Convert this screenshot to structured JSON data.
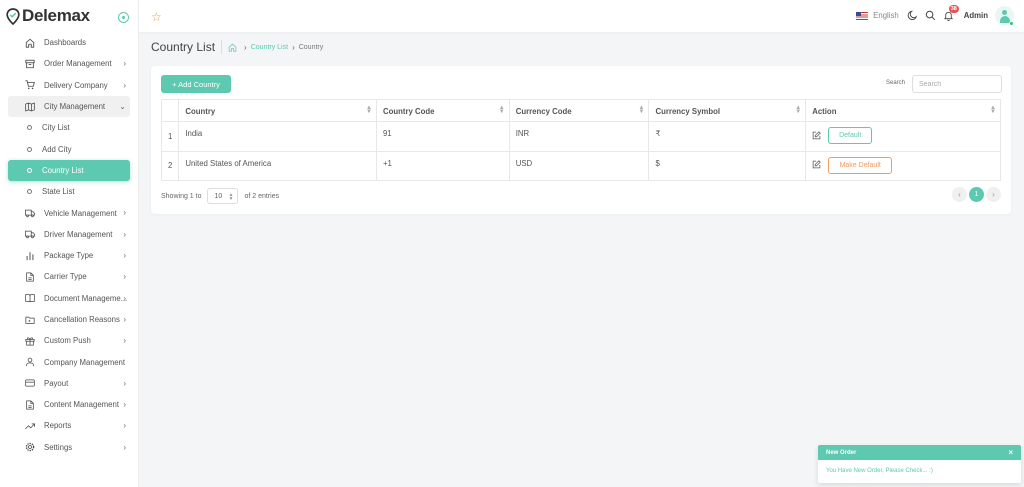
{
  "brand": {
    "name": "Delemax"
  },
  "sidebar": {
    "items": [
      {
        "label": "Dashboards",
        "icon": "home-icon"
      },
      {
        "label": "Order Management",
        "icon": "archive-icon",
        "chevron": true
      },
      {
        "label": "Delivery Company",
        "icon": "cart-icon",
        "chevron": true
      },
      {
        "label": "City Management",
        "icon": "map-icon",
        "chevron": true,
        "open": true
      },
      {
        "label": "City List",
        "sub": true
      },
      {
        "label": "Add City",
        "sub": true
      },
      {
        "label": "Country List",
        "sub": true,
        "active": true
      },
      {
        "label": "State List",
        "sub": true
      },
      {
        "label": "Vehicle Management",
        "icon": "truck-icon",
        "chevron": true
      },
      {
        "label": "Driver Management",
        "icon": "truck-icon",
        "chevron": true
      },
      {
        "label": "Package Type",
        "icon": "bar-chart-icon",
        "chevron": true
      },
      {
        "label": "Carrier Type",
        "icon": "file-icon",
        "chevron": true
      },
      {
        "label": "Document Manageme...",
        "icon": "book-icon",
        "chevron": true
      },
      {
        "label": "Cancellation Reasons",
        "icon": "folder-icon",
        "chevron": true
      },
      {
        "label": "Custom Push",
        "icon": "gift-icon",
        "chevron": true
      },
      {
        "label": "Company Management",
        "icon": "user-icon"
      },
      {
        "label": "Payout",
        "icon": "credit-card-icon",
        "chevron": true
      },
      {
        "label": "Content Management",
        "icon": "file-icon",
        "chevron": true
      },
      {
        "label": "Reports",
        "icon": "trending-up-icon",
        "chevron": true
      },
      {
        "label": "Settings",
        "icon": "gear-icon",
        "chevron": true
      }
    ]
  },
  "topbar": {
    "language": "English",
    "notification_count": "38",
    "user": "Admin"
  },
  "page": {
    "title": "Country List",
    "breadcrumb": {
      "link": "Country List",
      "current": "Country"
    }
  },
  "toolbar": {
    "add_label": "+ Add Country",
    "search_label": "Search",
    "search_placeholder": "Search"
  },
  "table": {
    "headers": [
      "Country",
      "Country Code",
      "Currency Code",
      "Currency Symbol",
      "Action"
    ],
    "rows": [
      {
        "idx": "1",
        "country": "India",
        "code": "91",
        "currency": "INR",
        "symbol": "₹",
        "action": "Default"
      },
      {
        "idx": "2",
        "country": "United States of America",
        "code": "+1",
        "currency": "USD",
        "symbol": "$",
        "action": "Make Default"
      }
    ]
  },
  "footer": {
    "showing": "Showing 1 to",
    "page_size": "10",
    "entries": "of 2 entries",
    "current_page": "1"
  },
  "toast": {
    "title": "New Order",
    "message": "You Have New Order, Please Check... :)"
  },
  "colors": {
    "accent": "#5cc9b0",
    "warning": "#f39a5d",
    "badge": "#ea5455"
  }
}
